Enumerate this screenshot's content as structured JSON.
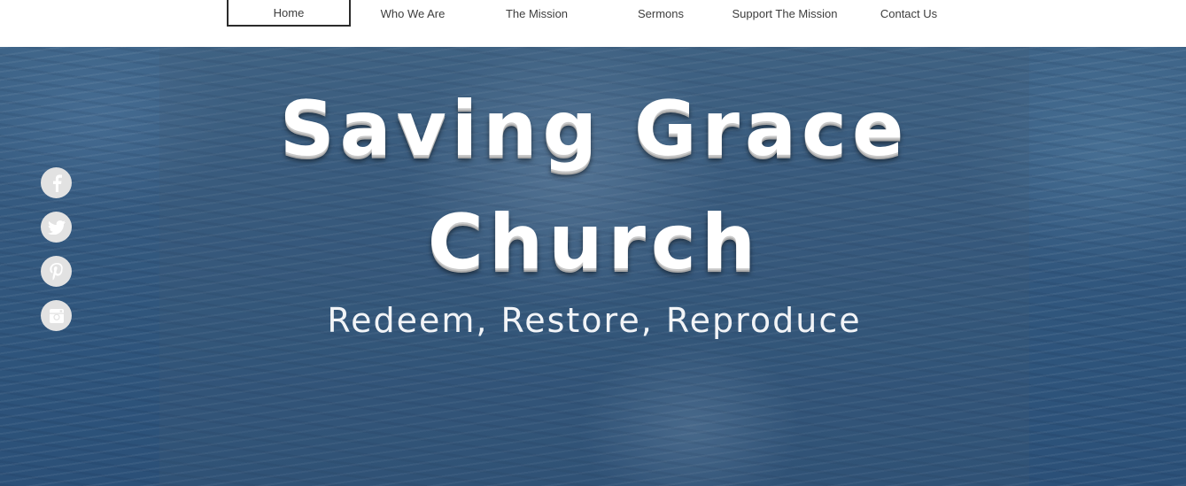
{
  "nav": {
    "items": [
      {
        "label": "Home",
        "active": true
      },
      {
        "label": "Who We Are",
        "active": false
      },
      {
        "label": "The Mission",
        "active": false
      },
      {
        "label": "Sermons",
        "active": false
      },
      {
        "label": "Support The Mission",
        "active": false
      },
      {
        "label": "Contact Us",
        "active": false
      }
    ]
  },
  "hero": {
    "title_line1": "Saving Grace",
    "title_line2": "Church",
    "tagline": "Redeem, Restore, Reproduce"
  },
  "social": {
    "icons": [
      "facebook-icon",
      "twitter-icon",
      "pinterest-icon",
      "instagram-icon"
    ],
    "icon_bg": "#e2e2e2"
  },
  "colors": {
    "nav_text": "#3d3d3d",
    "active_border": "#2b2b2b",
    "hero_water": "#2f557c",
    "title_text": "#ffffff"
  }
}
